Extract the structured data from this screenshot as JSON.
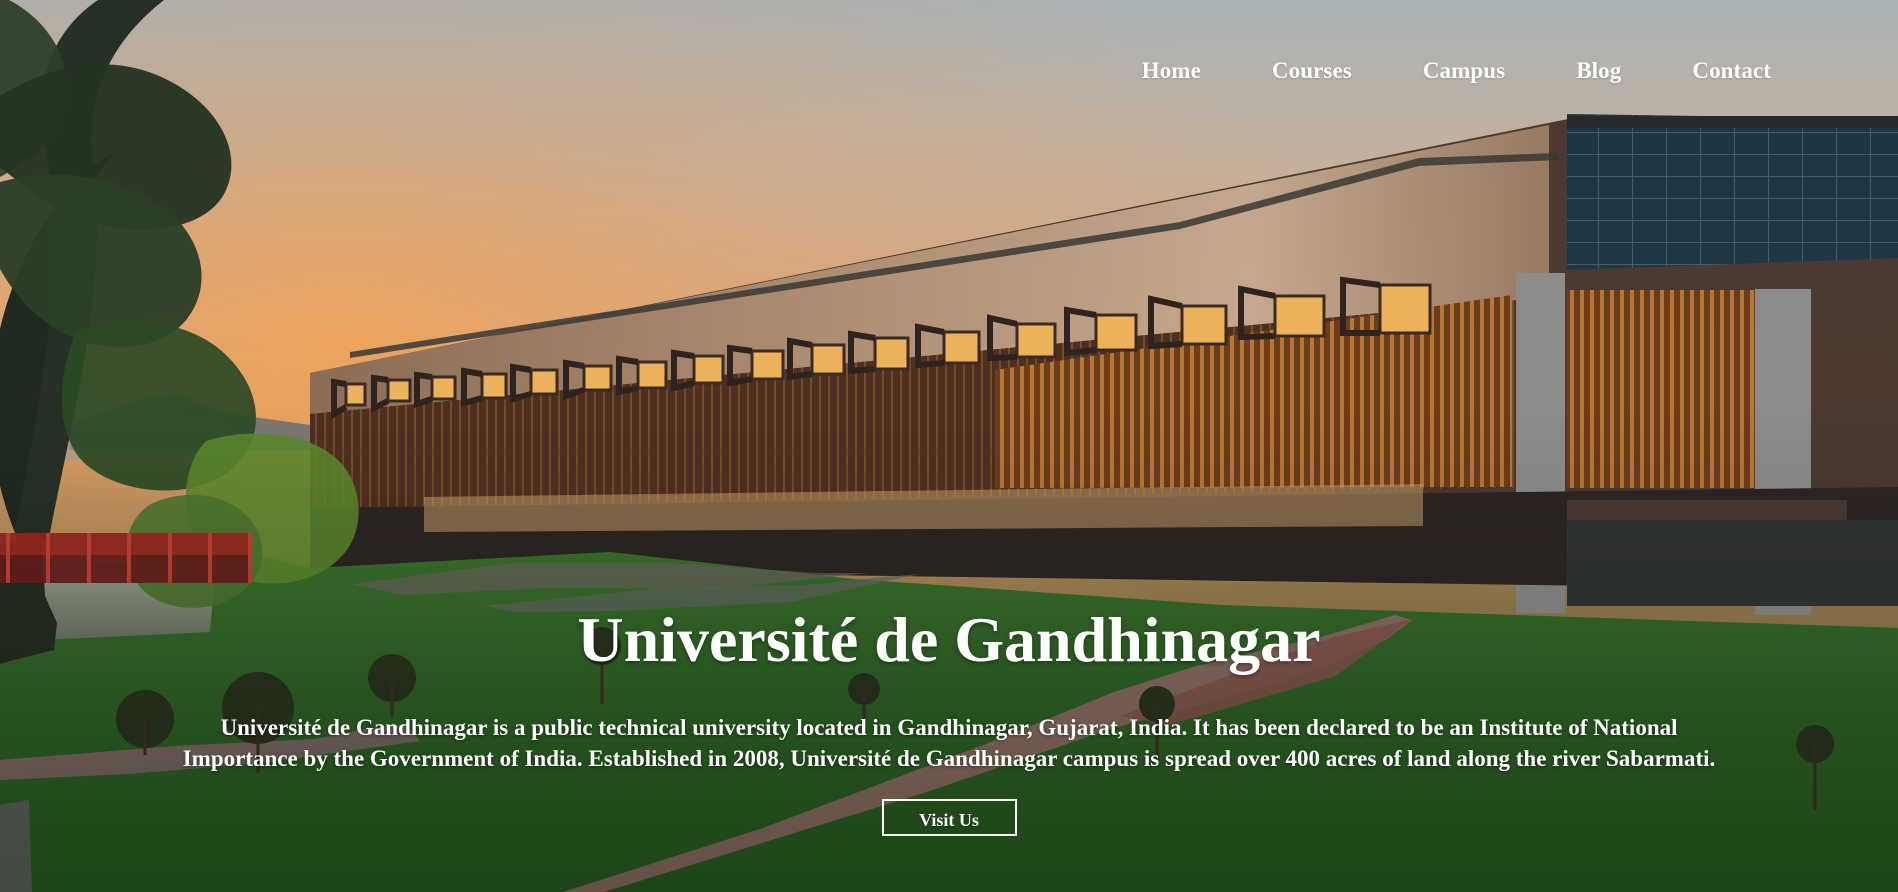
{
  "navigation": {
    "items": [
      {
        "label": "Home"
      },
      {
        "label": "Courses"
      },
      {
        "label": "Campus"
      },
      {
        "label": "Blog"
      },
      {
        "label": "Contact"
      }
    ]
  },
  "hero": {
    "title": "Université de Gandhinagar",
    "description": "Université de Gandhinagar is a public technical university located in Gandhinagar, Gujarat, India. It has been declared to be an Institute of National Importance by the Government of India. Established in 2008, Université de Gandhinagar campus is spread over 400 acres of land along the river Sabarmati.",
    "button_label": "Visit Us"
  },
  "colors": {
    "text": "#ffffff",
    "sunset_orange": "#efa25f",
    "grass_green": "#2f6a28",
    "building_tan": "#b89473"
  },
  "icons": {
    "background_image": "university-campus-photo"
  }
}
